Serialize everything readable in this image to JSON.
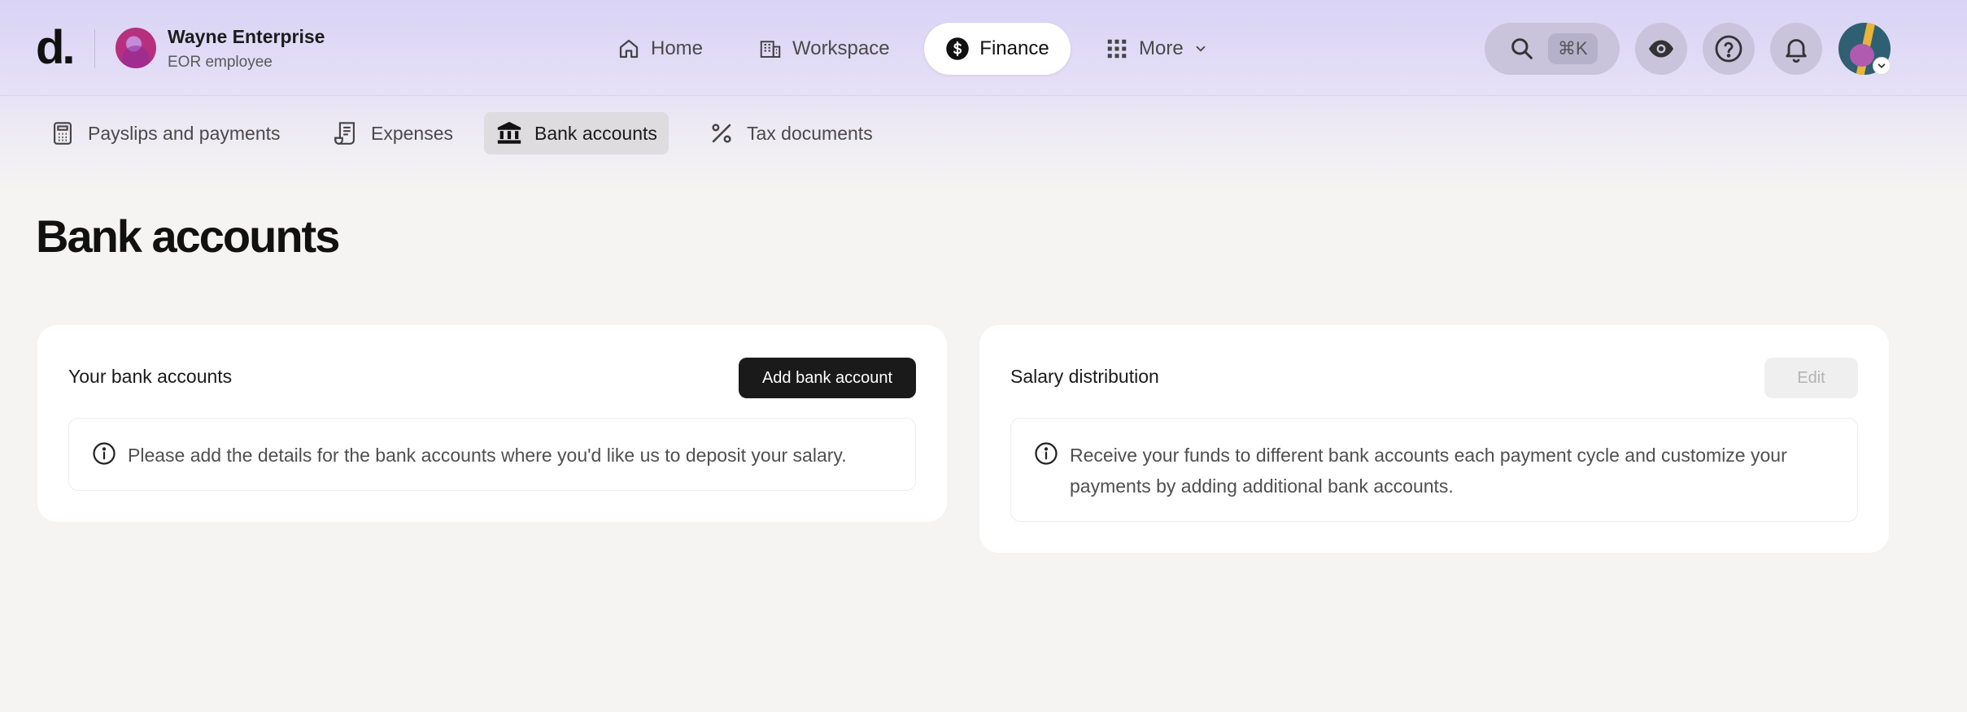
{
  "brand": {
    "logo": "d."
  },
  "org": {
    "name": "Wayne Enterprise",
    "role": "EOR employee"
  },
  "nav": {
    "home": "Home",
    "workspace": "Workspace",
    "finance": "Finance",
    "more": "More",
    "active": "Finance"
  },
  "search": {
    "shortcut": "⌘K",
    "icon": "search-icon"
  },
  "header_icons": [
    "eye-icon",
    "help-icon",
    "bell-icon"
  ],
  "subnav": {
    "payslips": "Payslips and payments",
    "expenses": "Expenses",
    "bank_accounts": "Bank accounts",
    "tax_documents": "Tax documents",
    "active": "Bank accounts"
  },
  "page": {
    "title": "Bank accounts"
  },
  "bank_accounts_card": {
    "title": "Your bank accounts",
    "button": "Add bank account",
    "notice": "Please add the details for the bank accounts where you'd like us to deposit your salary."
  },
  "salary_card": {
    "title": "Salary distribution",
    "button": "Edit",
    "notice": "Receive your funds to different bank accounts each payment cycle and customize your payments by adding additional bank accounts."
  },
  "colors": {
    "header_tint": "#d9d3f6",
    "background": "#f5f4f2",
    "primary_button": "#1a1a1a"
  }
}
